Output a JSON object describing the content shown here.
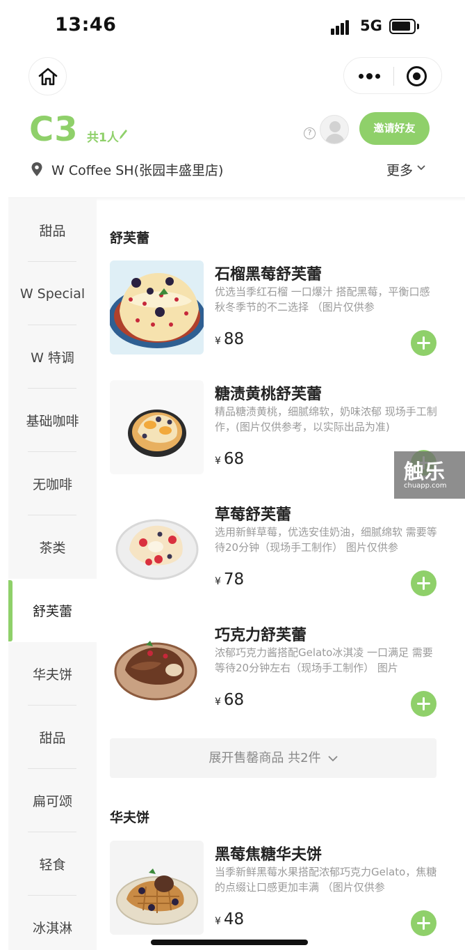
{
  "status_bar": {
    "time": "13:46",
    "network": "5G"
  },
  "header": {
    "table_no": "C3",
    "people": "共1人",
    "invite_label": "邀请好友",
    "help_glyph": "?",
    "store_name": "W Coffee SH(张园丰盛里店)",
    "more_label": "更多"
  },
  "colors": {
    "accent": "#8fd06a",
    "sidebar_bg": "#f7f7f7",
    "text_muted": "#9a9a9a"
  },
  "sidebar": {
    "items": [
      {
        "label": "甜品",
        "active": false
      },
      {
        "label": "W Special",
        "active": false
      },
      {
        "label": "W 特调",
        "active": false
      },
      {
        "label": "基础咖啡",
        "active": false
      },
      {
        "label": "无咖啡",
        "active": false
      },
      {
        "label": "茶类",
        "active": false
      },
      {
        "label": "舒芙蕾",
        "active": true
      },
      {
        "label": "华夫饼",
        "active": false
      },
      {
        "label": "甜品",
        "active": false
      },
      {
        "label": "扁可颂",
        "active": false
      },
      {
        "label": "轻食",
        "active": false
      },
      {
        "label": "冰淇淋",
        "active": false
      }
    ]
  },
  "sections": [
    {
      "title": "舒芙蕾",
      "products": [
        {
          "name": "石榴黑莓舒芙蕾",
          "desc": "优选当季红石榴 一口爆汁 搭配黑莓，平衡口感 秋冬季节的不二选择 （图片仅供参",
          "currency": "¥",
          "price": "88",
          "image": "pomegranate-blackberry-souffle"
        },
        {
          "name": "糖渍黄桃舒芙蕾",
          "desc": "精品糖渍黄桃，细腻绵软，奶味浓郁 现场手工制作，(图片仅供参考，以实际出品为准)",
          "currency": "¥",
          "price": "68",
          "image": "candied-peach-souffle"
        },
        {
          "name": "草莓舒芙蕾",
          "desc": "选用新鲜草莓，优选安佳奶油，细腻绵软 需要等待20分钟（现场手工制作） 图片仅供参",
          "currency": "¥",
          "price": "78",
          "image": "strawberry-souffle"
        },
        {
          "name": "巧克力舒芙蕾",
          "desc": "浓郁巧克力酱搭配Gelato冰淇凌 一口满足 需要等待20分钟左右（现场手工制作） 图片",
          "currency": "¥",
          "price": "68",
          "image": "chocolate-souffle"
        }
      ],
      "expand_label": "展开售罄商品 共2件"
    },
    {
      "title": "华夫饼",
      "products": [
        {
          "name": "黑莓焦糖华夫饼",
          "desc": "当季新鲜黑莓水果搭配浓郁巧克力Gelato，焦糖的点缀让口感更加丰满 （图片仅供参",
          "currency": "¥",
          "price": "48",
          "image": "blackberry-caramel-waffle"
        }
      ]
    }
  ],
  "watermark": {
    "title": "触乐",
    "subtitle": "chuapp.com"
  }
}
